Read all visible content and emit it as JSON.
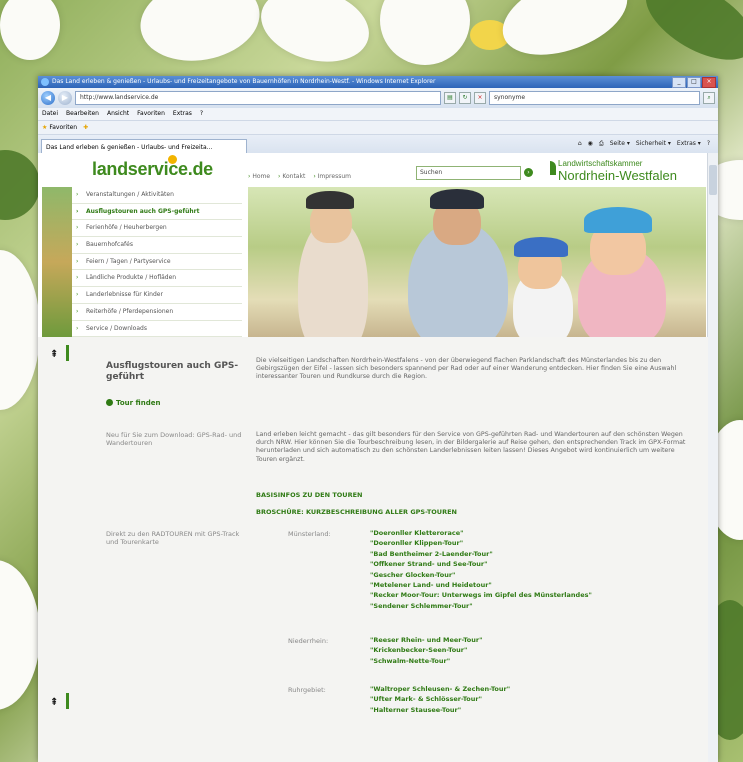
{
  "browser": {
    "window_title": "Das Land erleben & genießen - Urlaubs- und Freizeitangebote von Bauernhöfen in Nordrhein-Westf. - Windows Internet Explorer",
    "url": "http://www.landservice.de",
    "search_value": "synonyme",
    "menu": [
      "Datei",
      "Bearbeiten",
      "Ansicht",
      "Favoriten",
      "Extras",
      "?"
    ],
    "favorites_label": "Favoriten",
    "tab_title": "Das Land erleben & genießen - Urlaubs- und Freizeita...",
    "commands": [
      "Seite ▾",
      "Sicherheit ▾",
      "Extras ▾"
    ]
  },
  "site": {
    "logo": "landservice.de",
    "topnav": [
      "Home",
      "Kontakt",
      "Impressum"
    ],
    "search_placeholder": "Suchen",
    "lwk_line1": "Landwirtschaftskammer",
    "lwk_line2": "Nordrhein-Westfalen",
    "nav": [
      "Veranstaltungen / Aktivitäten",
      "Ausflugstouren auch GPS-geführt",
      "Ferienhöfe / Heuherbergen",
      "Bauernhofcafés",
      "Feiern / Tagen / Partyservice",
      "Ländliche Produkte / Hofläden",
      "Landerlebnisse für Kinder",
      "Reiterhöfe / Pferdepensionen",
      "Service / Downloads"
    ],
    "active_nav_index": 1
  },
  "content": {
    "title": "Ausflugstouren auch GPS-geführt",
    "intro": "Die vielseitigen Landschaften Nordrhein-Westfalens - von der überwiegend flachen Parklandschaft des Münsterlandes bis zu den Gebirgszügen der Eifel - lassen sich besonders spannend per Rad oder auf einer Wanderung entdecken. Hier finden Sie eine Auswahl interessanter Touren und Rundkurse durch die Region.",
    "tour_finden": "Tour finden",
    "gps_label": "Neu für Sie zum Download: GPS-Rad- und Wandertouren",
    "gps_text": "Land erleben leicht gemacht - das gilt besonders für den Service von GPS-geführten Rad- und Wandertouren auf den schönsten Wegen durch NRW. Hier können Sie die Tourbeschreibung lesen, in der Bildergalerie auf Reise gehen, den entsprechenden Track im GPX-Format herunterladen und sich automatisch zu den schönsten Landerlebnissen leiten lassen! Dieses Angebot wird kontinuierlich um weitere Touren ergänzt.",
    "link_basis": "BASISINFOS ZU DEN TOUREN",
    "link_brochure": "BROSCHÜRE: KURZBESCHREIBUNG ALLER GPS-TOUREN",
    "radtouren_label": "Direkt zu den RADTOUREN mit GPS-Track und Tourenkarte",
    "regions": [
      {
        "name": "Münsterland:",
        "tours": [
          "\"Doeronller Kletterorace\"",
          "\"Doeronller Klippen-Tour\"",
          "\"Bad Bentheimer 2-Laender-Tour\"",
          "\"Offkener Strand- und See-Tour\"",
          "\"Gescher Glocken-Tour\"",
          "\"Metelener Land- und Heidetour\"",
          "\"Recker Moor-Tour: Unterwegs im Gipfel des Münsterlandes\"",
          "\"Sendener Schlemmer-Tour\""
        ]
      },
      {
        "name": "Niederrhein:",
        "tours": [
          "\"Reeser Rhein- und Meer-Tour\"",
          "\"Krickenbecker-Seen-Tour\"",
          "\"Schwalm-Nette-Tour\""
        ]
      },
      {
        "name": "Ruhrgebiet:",
        "tours": [
          "\"Waltroper Schleusen- & Zechen-Tour\"",
          "\"Ufter Mark- & Schlösser-Tour\"",
          "\"Halterner Stausee-Tour\""
        ]
      }
    ]
  },
  "colors": {
    "brand_green": "#3e8a1e",
    "link_green": "#2f7a14",
    "ie_title": "#2d64b8"
  }
}
